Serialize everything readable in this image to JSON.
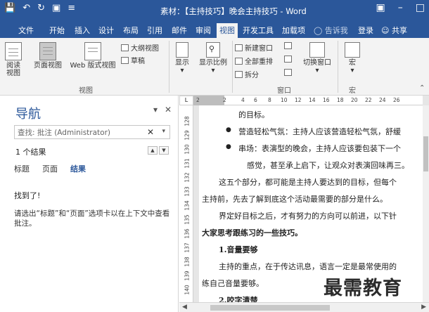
{
  "titlebar": {
    "title": "素材：【主持技巧】晚会主持技巧 - Word",
    "qat_icons": [
      "save-icon",
      "undo-icon",
      "redo-icon",
      "print-preview-icon",
      "customize-icon"
    ]
  },
  "tabs": {
    "file": "文件",
    "home": "开始",
    "insert": "插入",
    "design": "设计",
    "layout": "布局",
    "references": "引用",
    "mailings": "邮件",
    "review": "审阅",
    "view": "视图",
    "developer": "开发工具",
    "addins": "加载项",
    "tellme": "告诉我",
    "signin": "登录",
    "share": "共享"
  },
  "ribbon": {
    "views": {
      "read_mode": "阅读视图",
      "print_layout": "页面视图",
      "web_layout": "Web 版式视图",
      "outline": "大纲视图",
      "draft": "草稿",
      "group_label": "视图"
    },
    "show": {
      "label": "显示"
    },
    "zoom": {
      "label": "显示比例"
    },
    "window": {
      "new_window": "新建窗口",
      "arrange_all": "全部重排",
      "split": "拆分",
      "switch_windows": "切换窗口",
      "group_label": "窗口"
    },
    "macros": {
      "label": "宏",
      "group_label": "宏"
    }
  },
  "nav": {
    "title": "导航",
    "search_placeholder": "查找: 批注 (Administrator)",
    "result_count": "1 个结果",
    "tab_headings": "标题",
    "tab_pages": "页面",
    "tab_results": "结果",
    "found_text": "找到了!",
    "hint": "请选出“标题”和“页面”选项卡以在上下文中查看 批注。"
  },
  "ruler": {
    "corner": "L",
    "h_ticks": [
      "2",
      "2",
      "4",
      "6",
      "8",
      "10",
      "12",
      "14",
      "16",
      "18",
      "20",
      "22",
      "24",
      "26"
    ],
    "v_ticks": [
      "128",
      "129",
      "130",
      "131",
      "132",
      "133",
      "134",
      "135",
      "136",
      "137",
      "138",
      "139",
      "140",
      "141"
    ]
  },
  "document": {
    "lines": [
      "的目标。",
      "营造轻松气氛：主持人应该营造轻松气氛，舒缓",
      "串场：表演型的晚会，主持人应该要包装下一个",
      "感觉，甚至承上启下，让观众对表演回味再三。",
      "这五个部分，都可能是主持人要达到的目标，但每个",
      "主持前，先去了解到底这个活动最需要的部分是什么。",
      "界定好目标之后，才有努力的方向可以前进，以下针",
      "大家思考跟练习的一些技巧。",
      "1.音量要够",
      "主持的重点，在于传达讯息，语言一定是最常使用的",
      "练自己音量要够。",
      "2.咬字清楚"
    ]
  },
  "watermark": "最需教育"
}
